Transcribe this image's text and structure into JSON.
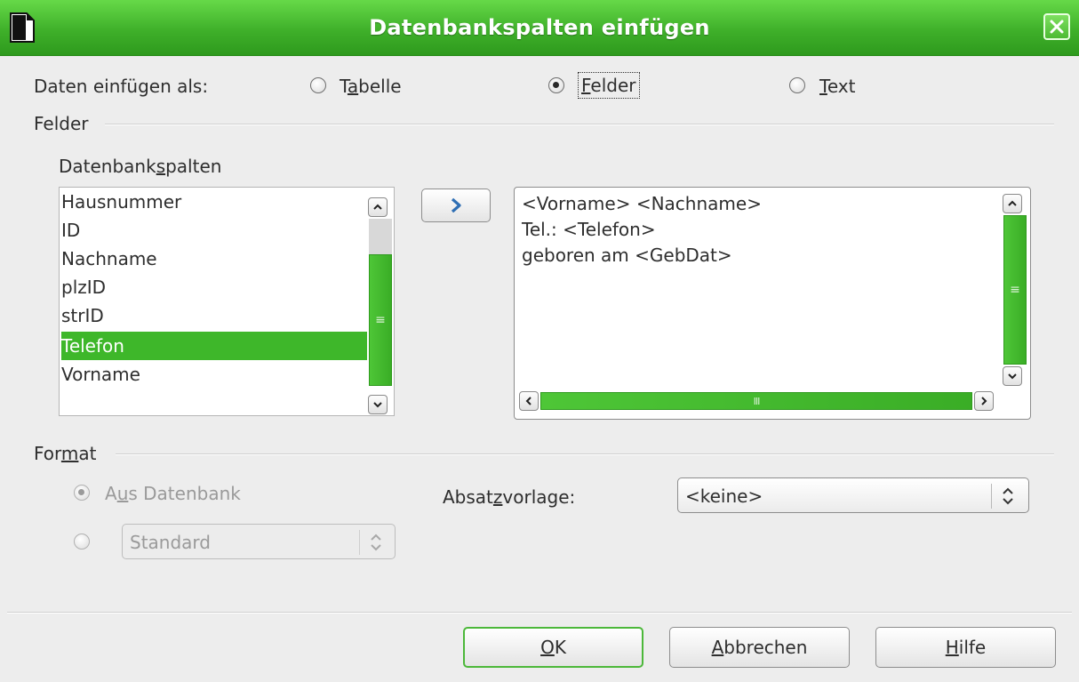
{
  "window": {
    "title": "Datenbankspalten einfügen",
    "accent_color": "#3fb02a"
  },
  "insert_as": {
    "label": "Daten einfügen als:",
    "options": [
      {
        "pre": "T",
        "key": "a",
        "post": "belle",
        "checked": false
      },
      {
        "pre": "",
        "key": "F",
        "post": "elder",
        "checked": true
      },
      {
        "pre": "",
        "key": "T",
        "post": "ext",
        "checked": false
      }
    ]
  },
  "fields": {
    "section_label": "Felder",
    "columns_label_pre": "Datenbank",
    "columns_label_key": "s",
    "columns_label_post": "palten",
    "columns": [
      "Hausnummer",
      "ID",
      "Nachname",
      "plzID",
      "strID",
      "Telefon",
      "Vorname"
    ],
    "selected_column": "Telefon",
    "move_button_icon": "chevron-right-icon",
    "text_lines": [
      "<Vorname>  <Nachname>",
      "Tel.:  <Telefon>",
      "geboren am <GebDat>"
    ],
    "scroll_grip_icon": "grip-icon",
    "hscroll_grip": "III",
    "vscroll_grip": "≡"
  },
  "format": {
    "section_label_pre": "For",
    "section_label_key": "m",
    "section_label_post": "at",
    "from_db_pre": "A",
    "from_db_key": "u",
    "from_db_post": "s Datenbank",
    "from_db_checked": true,
    "standard_value": "Standard",
    "paragraph_style_label_pre": "Absat",
    "paragraph_style_label_key": "z",
    "paragraph_style_label_post": "vorlage:",
    "paragraph_style_value": "<keine>"
  },
  "buttons": {
    "ok_key": "O",
    "ok_post": "K",
    "cancel_key": "A",
    "cancel_post": "bbrechen",
    "help_key": "H",
    "help_post": "ilfe"
  }
}
